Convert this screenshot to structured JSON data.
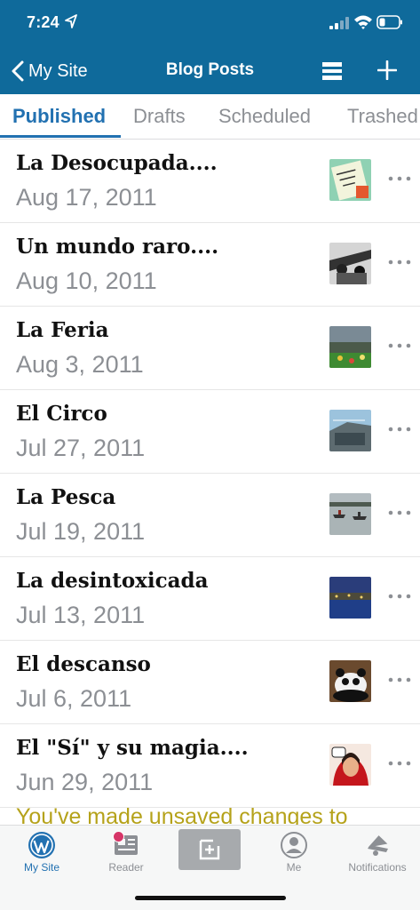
{
  "status": {
    "time": "7:24"
  },
  "nav": {
    "back_label": "My Site",
    "title": "Blog Posts"
  },
  "tabs": [
    {
      "label": "Published",
      "active": true
    },
    {
      "label": "Drafts",
      "active": false
    },
    {
      "label": "Scheduled",
      "active": false
    },
    {
      "label": "Trashed",
      "active": false
    }
  ],
  "posts": [
    {
      "title": "La Desocupada....",
      "date": "Aug 17, 2011",
      "thumb": "note-icon"
    },
    {
      "title": "Un mundo raro....",
      "date": "Aug 10, 2011",
      "thumb": "bw-photo"
    },
    {
      "title": "La Feria",
      "date": "Aug 3, 2011",
      "thumb": "fair-photo"
    },
    {
      "title": "El Circo",
      "date": "Jul 27, 2011",
      "thumb": "circus-photo"
    },
    {
      "title": "La Pesca",
      "date": "Jul 19, 2011",
      "thumb": "fishing-photo"
    },
    {
      "title": "La desintoxicada",
      "date": "Jul 13, 2011",
      "thumb": "night-photo"
    },
    {
      "title": "El descanso",
      "date": "Jul 6, 2011",
      "thumb": "panda-photo"
    },
    {
      "title": "El \"Sí\" y su magia....",
      "date": "Jun 29, 2011",
      "thumb": "woman-photo"
    }
  ],
  "warning": "You've made unsaved changes to",
  "tabbar": {
    "my_site": "My Site",
    "reader": "Reader",
    "me": "Me",
    "notifications": "Notifications"
  },
  "colors": {
    "header": "#0f6a9b",
    "accent": "#2271b1",
    "warning": "#b5a21a",
    "badge": "#d63668"
  }
}
